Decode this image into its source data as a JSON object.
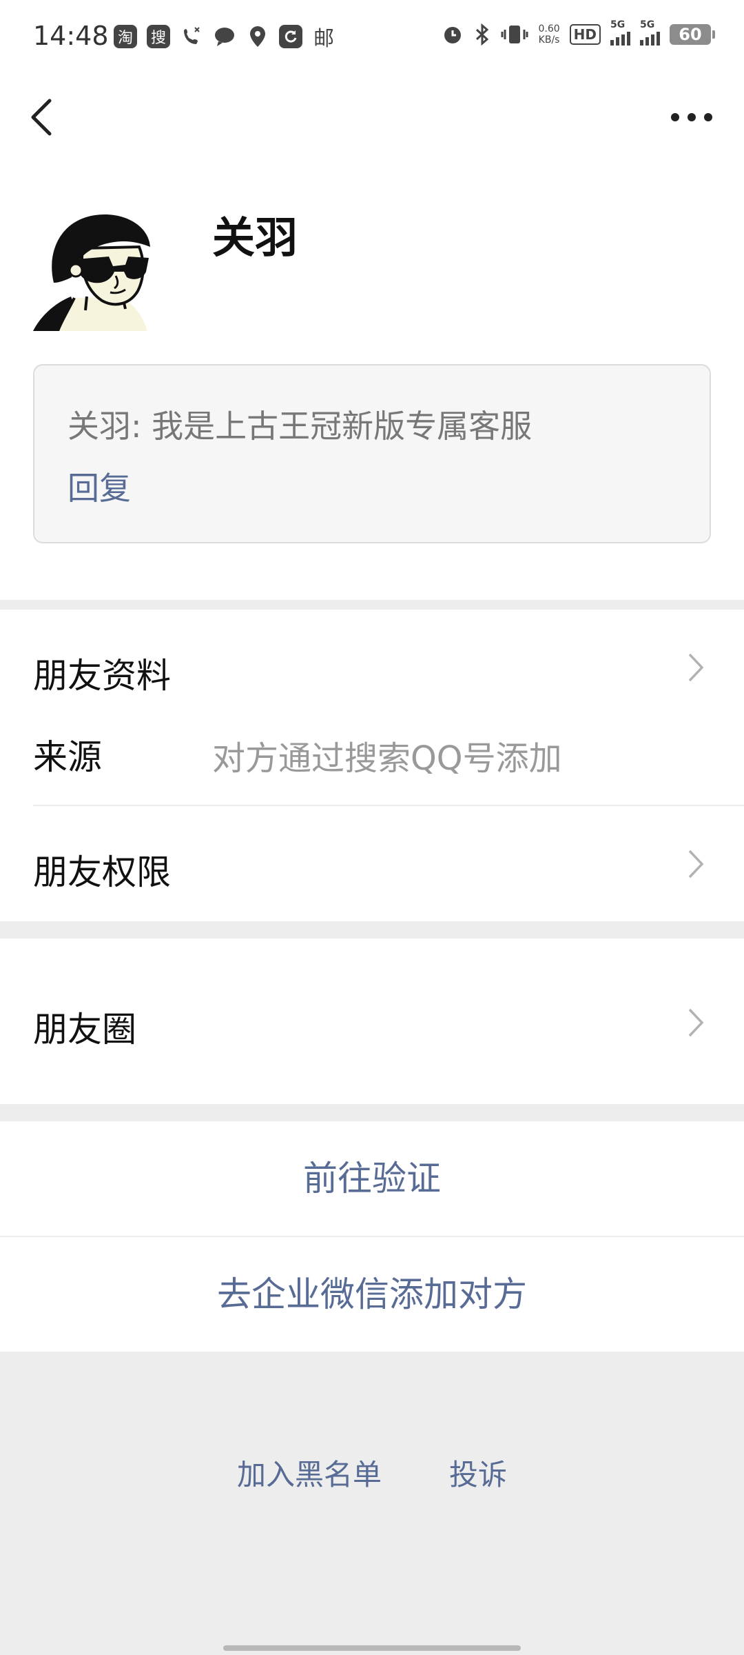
{
  "status_bar": {
    "time": "14:48",
    "left_icons": [
      "淘",
      "搜",
      "phone-missed-icon",
      "chat-bubble-icon",
      "location-du-icon",
      "refresh-app-icon",
      "邮"
    ],
    "net_speed_value": "0.60",
    "net_speed_unit": "KB/s",
    "hd_label": "HD",
    "network_1": "5G",
    "network_2": "5G",
    "battery": "60"
  },
  "contact": {
    "name": "关羽",
    "message": "关羽: 我是上古王冠新版专属客服",
    "reply_label": "回复"
  },
  "rows": {
    "profile_label": "朋友资料",
    "source_label": "来源",
    "source_value": "对方通过搜索QQ号添加",
    "permission_label": "朋友权限",
    "moments_label": "朋友圈"
  },
  "actions": {
    "verify": "前往验证",
    "wecom": "去企业微信添加对方"
  },
  "footer": {
    "blacklist": "加入黑名单",
    "report": "投诉"
  },
  "colors": {
    "link": "#576b95",
    "background": "#ededed"
  }
}
